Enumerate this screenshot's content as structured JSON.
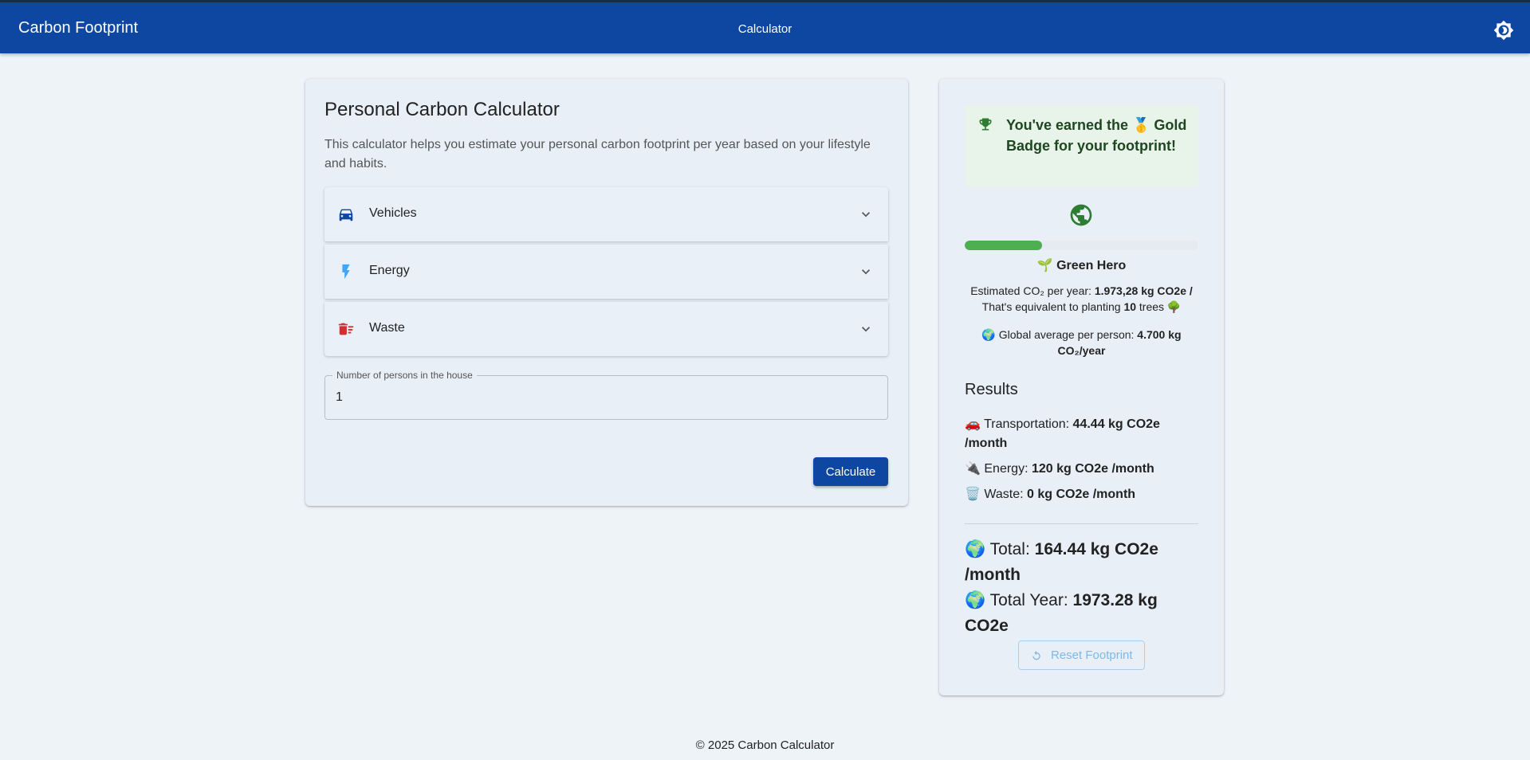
{
  "header": {
    "brand": "Carbon Footprint",
    "nav_label": "Calculator",
    "theme_icon": "brightness-icon"
  },
  "calculator": {
    "title": "Personal Carbon Calculator",
    "description": "This calculator helps you estimate your personal carbon footprint per year based on your lifestyle and habits.",
    "sections": [
      {
        "label": "Vehicles",
        "icon": "car-icon",
        "color": "#0d47a1"
      },
      {
        "label": "Energy",
        "icon": "lightning-icon",
        "color": "#42a5f5"
      },
      {
        "label": "Waste",
        "icon": "trash-icon",
        "color": "#d32f2f"
      }
    ],
    "persons_field": {
      "label": "Number of persons in the house",
      "value": "1"
    },
    "calculate_label": "Calculate"
  },
  "results": {
    "badge": {
      "text": "You've earned the 🥇 Gold Badge for your footprint!",
      "icon": "trophy-icon"
    },
    "globe_icon": "globe-icon",
    "progress_fraction": 0.33,
    "level_name": "🌱 Green Hero",
    "estimate": {
      "prefix": "Estimated CO₂ per year: ",
      "value": "1.973,28 kg CO2e /",
      "equiv_prefix": "That's equivalent to planting ",
      "trees": "10",
      "equiv_suffix": " trees 🌳"
    },
    "global_avg": {
      "prefix": "🌍 Global average per person: ",
      "value": "4.700 kg CO₂/year"
    },
    "title": "Results",
    "rows": [
      {
        "label": "🚗 Transportation: ",
        "value": "44.44 kg CO2e /month"
      },
      {
        "label": "🔌 Energy: ",
        "value": "120 kg CO2e /month"
      },
      {
        "label": "🗑️ Waste: ",
        "value": "0 kg CO2e /month"
      }
    ],
    "total_month": {
      "label": "🌍 Total: ",
      "value": "164.44 kg CO2e /month"
    },
    "total_year": {
      "label": "🌍 Total Year: ",
      "value": "1973.28 kg CO2e"
    },
    "reset_label": "Reset Footprint"
  },
  "footer": "© 2025 Carbon Calculator",
  "colors": {
    "primary": "#0d47a1",
    "progress": "#4caf50",
    "badge_bg": "#e8f4ea",
    "background": "#eef3f8"
  }
}
